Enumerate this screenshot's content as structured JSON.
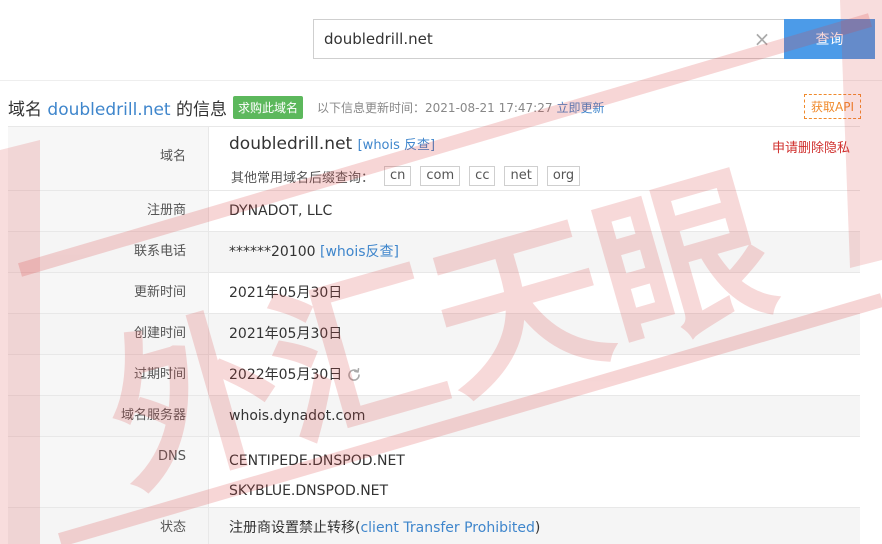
{
  "search": {
    "value": "doubledrill.net",
    "clear_icon": "×",
    "button_label": "查询"
  },
  "header": {
    "title_prefix": "域名 ",
    "title_domain": "doubledrill.net",
    "title_suffix": " 的信息",
    "buy_badge": "求购此域名",
    "update_info": "以下信息更新时间：2021-08-21 17:47:27",
    "update_link": "立即更新",
    "api_button": "获取API"
  },
  "domain": {
    "label": "域名",
    "value": "doubledrill.net",
    "whois_link": "[whois 反查]",
    "privacy_link": "申请删除隐私",
    "suffix_label": "其他常用域名后缀查询：",
    "suffixes": [
      "cn",
      "com",
      "cc",
      "net",
      "org"
    ]
  },
  "registrar": {
    "label": "注册商",
    "value": "DYNADOT, LLC"
  },
  "phone": {
    "label": "联系电话",
    "value": "******20100",
    "link": "[whois反查]"
  },
  "updated": {
    "label": "更新时间",
    "value": "2021年05月30日"
  },
  "created": {
    "label": "创建时间",
    "value": "2021年05月30日"
  },
  "expires": {
    "label": "过期时间",
    "value": "2022年05月30日",
    "icon": "refresh-icon"
  },
  "nameserver": {
    "label": "域名服务器",
    "value": "whois.dynadot.com"
  },
  "dns": {
    "label": "DNS",
    "servers": [
      "CENTIPEDE.DNSPOD.NET",
      "SKYBLUE.DNSPOD.NET"
    ]
  },
  "status": {
    "label": "状态",
    "value_prefix": "注册商设置禁止转移(",
    "value_code": "client Transfer Prohibited",
    "value_suffix": ")"
  },
  "watermark": {
    "text": "外汇天眼",
    "color": "#d94545"
  },
  "colors": {
    "accent": "#4c9be8",
    "link": "#3f86cc",
    "badge": "#5cb85c",
    "api": "#f08a2c",
    "warning": "#d0302e"
  }
}
